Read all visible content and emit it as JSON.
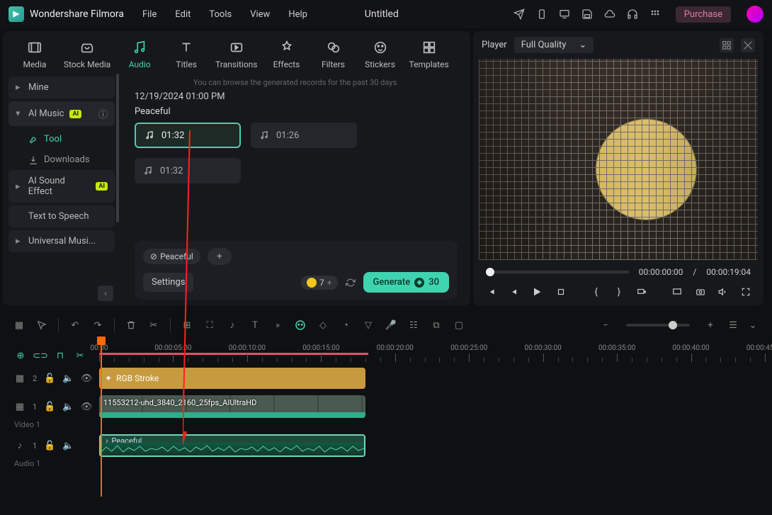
{
  "app_name": "Wondershare Filmora",
  "doc_title": "Untitled",
  "menubar": [
    "File",
    "Edit",
    "Tools",
    "View",
    "Help"
  ],
  "purchase": "Purchase",
  "media_tabs": [
    {
      "label": "Media"
    },
    {
      "label": "Stock Media"
    },
    {
      "label": "Audio"
    },
    {
      "label": "Titles"
    },
    {
      "label": "Transitions"
    },
    {
      "label": "Effects"
    },
    {
      "label": "Filters"
    },
    {
      "label": "Stickers"
    },
    {
      "label": "Templates"
    }
  ],
  "sidebar": {
    "mine": "Mine",
    "ai_music": "AI Music",
    "tool": "Tool",
    "downloads": "Downloads",
    "ai_sound": "AI Sound Effect",
    "tts": "Text to Speech",
    "universal": "Universal Musi...",
    "ai_badge": "AI"
  },
  "panel": {
    "hint": "You can browse the generated records for the past 30 days.",
    "timestamp": "12/19/2024 01:00 PM",
    "mood": "Peaceful",
    "clips": [
      "01:32",
      "01:26",
      "01:32"
    ],
    "tag": "Peaceful",
    "settings": "Settings",
    "token_count": "7",
    "generate": "Generate",
    "gen_cost": "30"
  },
  "player": {
    "label": "Player",
    "quality": "Full Quality",
    "current": "00:00:00:00",
    "sep": "/",
    "duration": "00:00:19:04",
    "markers": {
      "open": "{",
      "close": "}"
    }
  },
  "ruler": {
    "labels": [
      "00:00",
      "00:00:05:00",
      "00:00:10:00",
      "00:00:15:00",
      "00:00:20:00",
      "00:00:25:00",
      "00:00:30:00",
      "00:00:35:00",
      "00:00:40:00",
      "00:00:45:00"
    ]
  },
  "tracks": {
    "fx_label": "RGB Stroke",
    "vid_label": "11553212-uhd_3840_2160_25fps_AIUltraHD",
    "video_idx": "2",
    "video1_idx": "1",
    "audio_idx": "1",
    "video_name": "Video 1",
    "audio_name": "Audio 1",
    "audio_clip": "Peaceful"
  }
}
